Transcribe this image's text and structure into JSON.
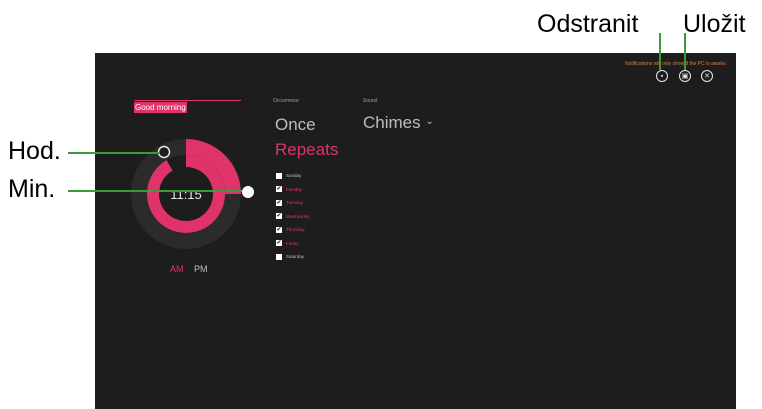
{
  "callouts": {
    "delete": "Odstranit",
    "save": "Uložit",
    "hour": "Hod.",
    "minute": "Min."
  },
  "alarm": {
    "notification": "Notifications will only show if the PC is awake.",
    "name": "Good morning",
    "time": "11:15",
    "occurrence_label": "Occurrence",
    "sound_label": "Sound",
    "once": "Once",
    "repeats": "Repeats",
    "sound": "Chimes",
    "sound_chevron": "⌄",
    "am": "AM",
    "pm": "PM",
    "hour_ring_fraction": 0.917,
    "minute_ring_fraction": 0.25,
    "days": [
      {
        "label": "Sunday",
        "checked": false
      },
      {
        "label": "Monday",
        "checked": true
      },
      {
        "label": "Tuesday",
        "checked": true
      },
      {
        "label": "Wednesday",
        "checked": true
      },
      {
        "label": "Thursday",
        "checked": true
      },
      {
        "label": "Friday",
        "checked": true
      },
      {
        "label": "Saturday",
        "checked": false
      }
    ]
  },
  "colors": {
    "accent": "#e0336a",
    "background": "#1d1d1d",
    "ring_dark": "#2b2b2b",
    "leader": "#3c9a3c",
    "notification": "#e07a3c"
  },
  "icons": {
    "delete": "trash-icon",
    "save": "save-icon",
    "close": "close-icon"
  }
}
